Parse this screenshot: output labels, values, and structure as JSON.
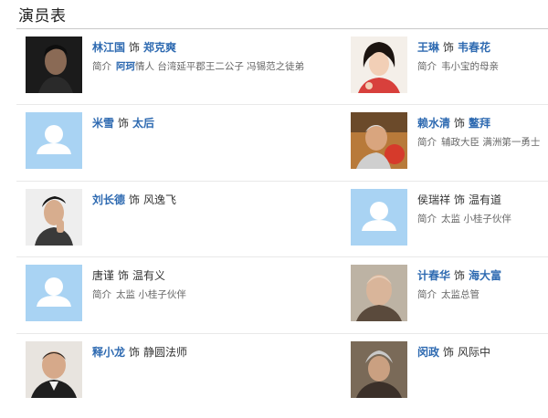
{
  "section_title": "演员表",
  "role_word": "饰",
  "intro_label": "简介",
  "cast": [
    {
      "actor": "林江国",
      "role": "郑克爽",
      "desc_highlight": "阿珂",
      "desc_text": "情人 台湾延平郡王二公子 冯锡范之徒弟",
      "photo": "actor-photo",
      "actor_link": true,
      "role_link": true
    },
    {
      "actor": "王琳",
      "role": "韦春花",
      "desc_highlight": "",
      "desc_text": "韦小宝的母亲",
      "photo": "actress-photo",
      "actor_link": true,
      "role_link": true
    },
    {
      "actor": "米雪",
      "role": "太后",
      "desc_highlight": "",
      "desc_text": "",
      "photo": "placeholder-avatar",
      "actor_link": true,
      "role_link": true
    },
    {
      "actor": "赖水清",
      "role": "鳌拜",
      "desc_highlight": "",
      "desc_text": "辅政大臣 满洲第一勇士",
      "photo": "actor-photo",
      "actor_link": true,
      "role_link": true
    },
    {
      "actor": "刘长德",
      "role": "风逸飞",
      "desc_highlight": "",
      "desc_text": "",
      "photo": "actor-photo",
      "actor_link": true,
      "role_link": false
    },
    {
      "actor": "侯瑞祥",
      "role": "温有道",
      "desc_highlight": "",
      "desc_text": "太监 小桂子伙伴",
      "photo": "placeholder-avatar",
      "actor_link": false,
      "role_link": false
    },
    {
      "actor": "唐谨",
      "role": "温有义",
      "desc_highlight": "",
      "desc_text": "太监 小桂子伙伴",
      "photo": "placeholder-avatar",
      "actor_link": false,
      "role_link": false
    },
    {
      "actor": "计春华",
      "role": "海大富",
      "desc_highlight": "",
      "desc_text": "太监总管",
      "photo": "actor-photo",
      "actor_link": true,
      "role_link": true
    },
    {
      "actor": "释小龙",
      "role": "静圆法师",
      "desc_highlight": "",
      "desc_text": "",
      "photo": "actor-photo",
      "actor_link": true,
      "role_link": false
    },
    {
      "actor": "闵政",
      "role": "风际中",
      "desc_highlight": "",
      "desc_text": "",
      "photo": "actor-photo",
      "actor_link": true,
      "role_link": false
    }
  ],
  "colors": {
    "link": "#2e6ab1",
    "text": "#333333",
    "muted": "#666666",
    "placeholder_bg": "#aed6f5"
  }
}
